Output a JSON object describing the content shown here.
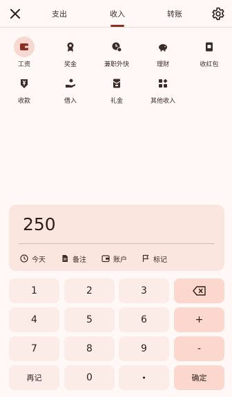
{
  "tabs": [
    {
      "label": "支出"
    },
    {
      "label": "收入"
    },
    {
      "label": "转账"
    }
  ],
  "categories": [
    {
      "label": "工资"
    },
    {
      "label": "奖金"
    },
    {
      "label": "兼职外快"
    },
    {
      "label": "理财"
    },
    {
      "label": "收红包"
    },
    {
      "label": "收款"
    },
    {
      "label": "借入"
    },
    {
      "label": "礼金"
    },
    {
      "label": "其他收入"
    }
  ],
  "amount": "250",
  "meta": {
    "date": "今天",
    "note": "备注",
    "account": "账户",
    "tag": "标记"
  },
  "keypad": {
    "k1": "1",
    "k2": "2",
    "k3": "3",
    "k4": "4",
    "k5": "5",
    "k6": "6",
    "k7": "7",
    "k8": "8",
    "k9": "9",
    "k0": "0",
    "plus": "+",
    "minus": "-",
    "dot": "•",
    "again": "再记",
    "confirm": "确定"
  },
  "colors": {
    "accent": "#8a2f22",
    "background": "#fff8f6",
    "panel": "#fbe6df",
    "key": "#fbece8",
    "op_key": "#fbd7cd"
  }
}
